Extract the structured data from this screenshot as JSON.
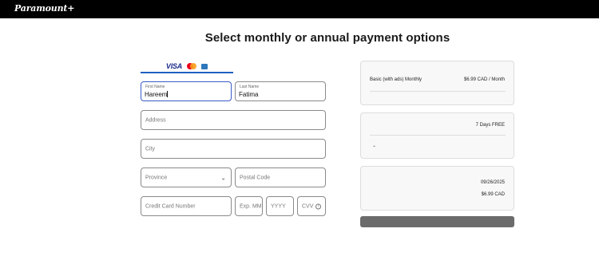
{
  "header": {
    "logo_text": "Paramount+"
  },
  "page": {
    "title": "Select monthly or annual payment options"
  },
  "card_tab": {
    "brands": [
      "VISA",
      "mastercard",
      "amex"
    ]
  },
  "form": {
    "first_name": {
      "label": "First Name",
      "value": "Hareem"
    },
    "last_name": {
      "label": "Last Name",
      "value": "Fatima"
    },
    "address": {
      "placeholder": "Address"
    },
    "city": {
      "placeholder": "City"
    },
    "province": {
      "placeholder": "Province"
    },
    "postal_code": {
      "placeholder": "Postal Code"
    },
    "card_number": {
      "placeholder": "Credit Card Number"
    },
    "exp_mm": {
      "placeholder": "Exp. MM"
    },
    "exp_yyyy": {
      "placeholder": "YYYY"
    },
    "cvv": {
      "placeholder": "CVV",
      "info_icon": "i"
    }
  },
  "summary": {
    "plan": {
      "name": "Basic (with ads) Monthly",
      "price": "$6.99 CAD / Month"
    },
    "trial": {
      "label": "7 Days FREE"
    },
    "billing": {
      "date": "09/26/2025",
      "amount": "$6.99 CAD"
    }
  },
  "colors": {
    "accent": "#1f5fbf",
    "button": "#6b6b6b",
    "topbar": "#000000"
  }
}
